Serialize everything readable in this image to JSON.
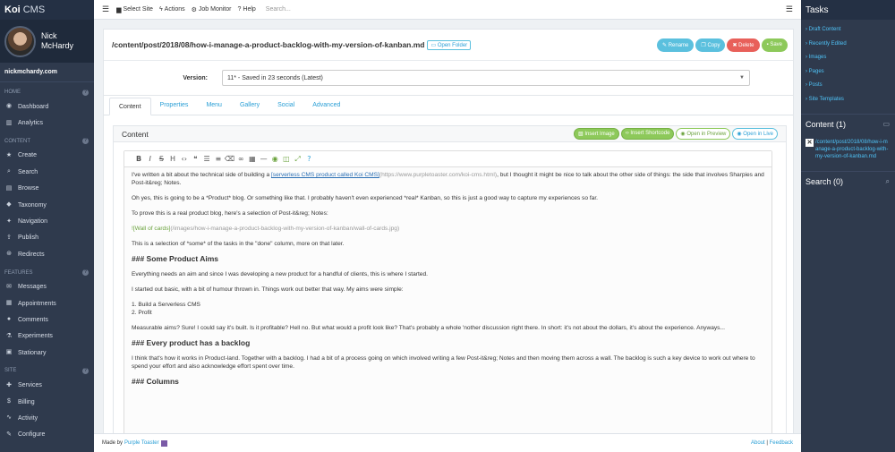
{
  "sidebar": {
    "brand": "Koi",
    "brand_suffix": "CMS",
    "user_first": "Nick",
    "user_last": "McHardy",
    "site": "nickmchardy.com",
    "sections": [
      {
        "label": "Home",
        "items": [
          {
            "label": "Dashboard",
            "icon": "dashboard-icon",
            "glyph": "◉"
          },
          {
            "label": "Analytics",
            "icon": "chart-icon",
            "glyph": "▥"
          }
        ]
      },
      {
        "label": "Content",
        "items": [
          {
            "label": "Create",
            "icon": "star-icon",
            "glyph": "★"
          },
          {
            "label": "Search",
            "icon": "search-icon",
            "glyph": "⌕"
          },
          {
            "label": "Browse",
            "icon": "folder-icon",
            "glyph": "▤"
          },
          {
            "label": "Taxonomy",
            "icon": "tag-icon",
            "glyph": "◆"
          },
          {
            "label": "Navigation",
            "icon": "compass-icon",
            "glyph": "✦"
          },
          {
            "label": "Publish",
            "icon": "upload-icon",
            "glyph": "⇪"
          },
          {
            "label": "Redirects",
            "icon": "redirect-icon",
            "glyph": "⊛"
          }
        ]
      },
      {
        "label": "Features",
        "items": [
          {
            "label": "Messages",
            "icon": "envelope-icon",
            "glyph": "✉"
          },
          {
            "label": "Appointments",
            "icon": "calendar-icon",
            "glyph": "▦"
          },
          {
            "label": "Comments",
            "icon": "comment-icon",
            "glyph": "●"
          },
          {
            "label": "Experiments",
            "icon": "flask-icon",
            "glyph": "⚗"
          },
          {
            "label": "Stationary",
            "icon": "print-icon",
            "glyph": "▣"
          }
        ]
      },
      {
        "label": "Site",
        "items": [
          {
            "label": "Services",
            "icon": "puzzle-icon",
            "glyph": "✚"
          },
          {
            "label": "Billing",
            "icon": "dollar-icon",
            "glyph": "$"
          },
          {
            "label": "Activity",
            "icon": "activity-icon",
            "glyph": "∿"
          },
          {
            "label": "Configure",
            "icon": "wrench-icon",
            "glyph": "✎"
          }
        ]
      }
    ]
  },
  "topbar": {
    "select_site": "Select Site",
    "actions": "Actions",
    "job_monitor": "Job Monitor",
    "help": "Help",
    "search_placeholder": "Search..."
  },
  "file": {
    "path": "/content/post/2018/08/how-i-manage-a-product-backlog-with-my-version-of-kanban.md",
    "open_folder": "Open Folder",
    "buttons": {
      "rename": "Rename",
      "copy": "Copy",
      "delete": "Delete",
      "save": "Save"
    },
    "version_label": "Version:",
    "version_value": "11* - Saved in 23 seconds (Latest)"
  },
  "tabs": [
    "Content",
    "Properties",
    "Menu",
    "Gallery",
    "Social",
    "Advanced"
  ],
  "content_panel": {
    "title": "Content",
    "insert_image": "Insert Image",
    "insert_shortcode": "Insert Shortcode",
    "open_preview": "Open in Preview",
    "open_live": "Open in Live"
  },
  "editor": {
    "p1_a": "I've written a bit about the technical side of building a ",
    "p1_link": "[serverless CMS product called Koi CMS]",
    "p1_url": "(https://www.purpletoaster.com/koi-cms.html)",
    "p1_b": ", but I thought it might be nice to talk about the other side of things: the side that involves Sharpies and Post-it&reg; Notes.",
    "p2": "Oh yes, this is going to be a *Product* blog. Or something like that. I probably haven't even experienced *real* Kanban, so this is just a good way to capture my experiences so far.",
    "p3": "To prove this is a real product blog, here's a selection of Post-it&reg; Notes:",
    "p4_img": "![Wall of cards]",
    "p4_url": "(/images/how-i-manage-a-product-backlog-with-my-version-of-kanban/wall-of-cards.jpg)",
    "p5": "This is a selection of *some* of the tasks in the \"done\" column, more on that later.",
    "h1": "### Some Product Aims",
    "p6": "Everything needs an aim and since I was developing a new product for a handful of clients, this is where I started.",
    "p7": "I started out basic, with a bit of humour thrown in. Things work out better that way. My aims were simple:",
    "li1": "1. Build a Serverless CMS",
    "li2": "2. Profit",
    "p8": "Measurable aims? Sure! I could say it's built. Is it profitable? Hell no. But what would a profit look like? That's probably a whole 'nother discussion right there. In short: it's not about the dollars, it's about the experience. Anyways...",
    "h2": "### Every product has a backlog",
    "p9": "I think that's how it works in Product-land. Together with a backlog. I had a bit of a process going on which involved writing a few Post-it&reg; Notes and then moving them across a wall. The backlog is such a key device to work out where to spend your effort and also acknowledge effort spent over time.",
    "h3": "### Columns"
  },
  "footer": {
    "made_by": "Made by",
    "company": "Purple Toaster",
    "about": "About",
    "sep": "|",
    "feedback": "Feedback"
  },
  "tasks": {
    "title": "Tasks",
    "links": [
      "Draft Content",
      "Recently Edited",
      "Images",
      "Pages",
      "Posts",
      "Site Templates"
    ],
    "content_header": "Content (1)",
    "content_file": "/content/post/2018/08/how-i-manage-a-product-backlog-with-my-version-of-kanban.md",
    "search_header": "Search (0)"
  }
}
